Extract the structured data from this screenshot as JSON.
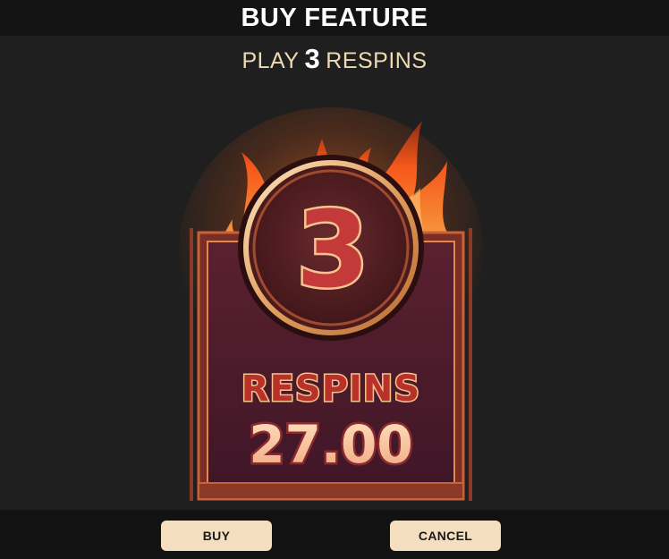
{
  "header": {
    "title": "BUY FEATURE"
  },
  "subtitle": {
    "prefix": "PLAY",
    "count": "3",
    "suffix": "RESPINS"
  },
  "card": {
    "badge_number": "3",
    "label": "RESPINS",
    "price": "27.00",
    "colors": {
      "panel": "#4a1c2c",
      "frame": "#c8623a",
      "gold": "#f0c489",
      "flame": "#ff7a1a",
      "number_fill": "#c43a3a"
    }
  },
  "footer": {
    "buy_label": "BUY",
    "cancel_label": "CANCEL"
  }
}
